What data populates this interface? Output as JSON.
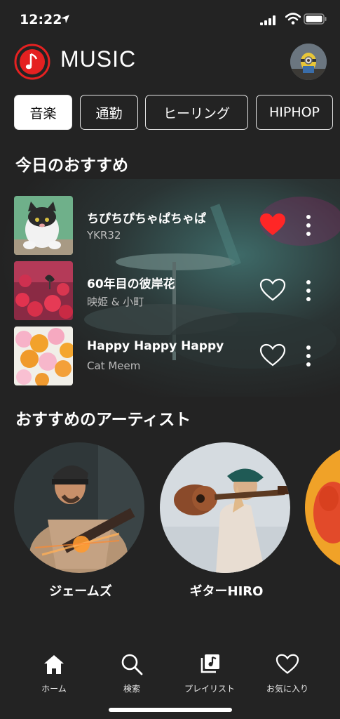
{
  "status_bar": {
    "time": "12:22"
  },
  "header": {
    "title": "MUSIC"
  },
  "genres": [
    {
      "label": "音楽",
      "active": true
    },
    {
      "label": "通勤",
      "active": false
    },
    {
      "label": "ヒーリング",
      "active": false
    },
    {
      "label": "HIPHOP",
      "active": false
    }
  ],
  "recommended": {
    "title": "今日のおすすめ",
    "tracks": [
      {
        "title": "ちぴちぴちゃぱちゃぱ",
        "artist": "YKR32",
        "liked": true
      },
      {
        "title": "60年目の彼岸花",
        "artist": "映姫 & 小町",
        "liked": false
      },
      {
        "title": "Happy Happy Happy",
        "artist": "Cat Meem",
        "liked": false
      }
    ]
  },
  "artists_section": {
    "title": "おすすめのアーティスト",
    "artists": [
      {
        "name": "ジェームズ"
      },
      {
        "name": "ギターHIRO"
      },
      {
        "name": ""
      }
    ]
  },
  "tabbar": {
    "items": [
      {
        "label": "ホーム",
        "icon": "home-icon"
      },
      {
        "label": "検索",
        "icon": "search-icon"
      },
      {
        "label": "プレイリスト",
        "icon": "playlist-icon"
      },
      {
        "label": "お気に入り",
        "icon": "heart-icon"
      }
    ]
  },
  "colors": {
    "background": "#232323",
    "accent": "#e52121",
    "chip_active_bg": "#ffffff"
  }
}
